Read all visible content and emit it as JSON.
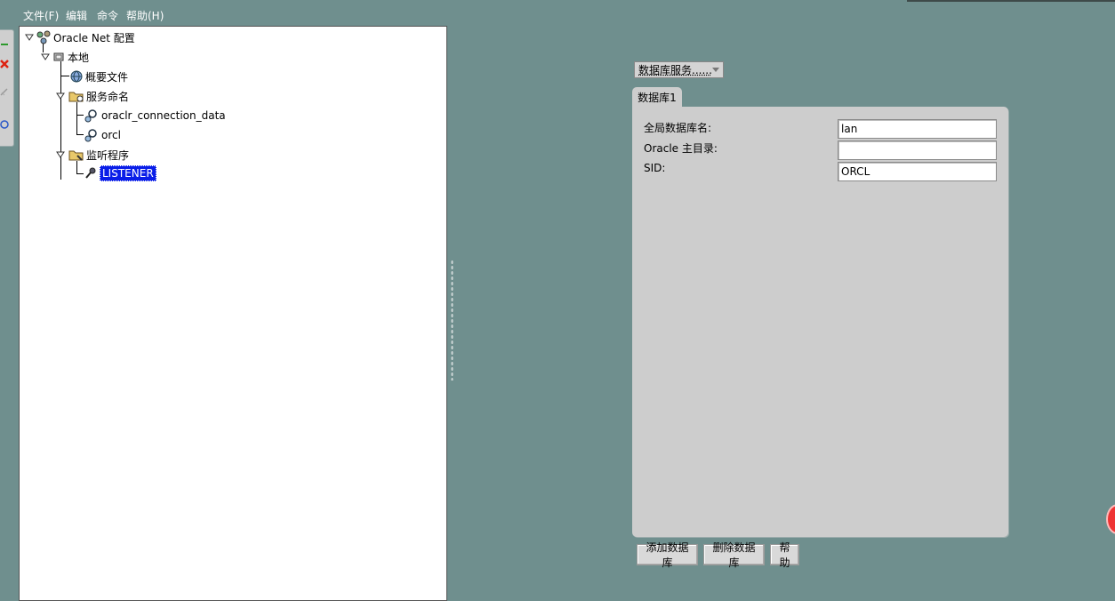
{
  "menu": {
    "file": "文件(F)",
    "edit": "编辑",
    "command": "命令",
    "help": "帮助(H)"
  },
  "tree": {
    "root": "Oracle Net 配置",
    "local": "本地",
    "profile": "概要文件",
    "service_naming": "服务命名",
    "services": [
      "oraclr_connection_data",
      "orcl"
    ],
    "listeners_folder": "监听程序",
    "listener": "LISTENER"
  },
  "detail": {
    "view_select": "数据库服务......",
    "tab": "数据库1",
    "fields": [
      {
        "label": "全局数据库名:",
        "value": "lan"
      },
      {
        "label": "Oracle 主目录:",
        "value": ""
      },
      {
        "label": "SID:",
        "value": "ORCL"
      }
    ],
    "buttons": {
      "add": "添加数据库",
      "remove": "删除数据库",
      "help": "帮助"
    }
  },
  "colors": {
    "background": "#6f8f8e",
    "panel": "#cdcdcd",
    "selection": "#0a1ee8"
  }
}
